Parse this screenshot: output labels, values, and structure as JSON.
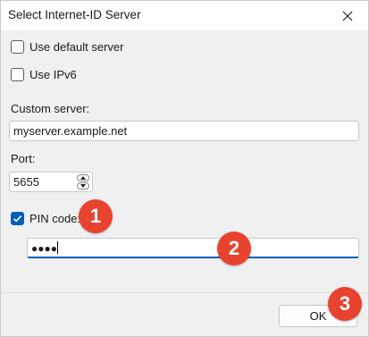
{
  "window": {
    "title": "Select Internet-ID Server",
    "close_icon": "close-icon"
  },
  "options": {
    "use_default_server": {
      "label": "Use default server",
      "checked": false
    },
    "use_ipv6": {
      "label": "Use IPv6",
      "checked": false
    }
  },
  "custom_server": {
    "label": "Custom server:",
    "value": "myserver.example.net"
  },
  "port": {
    "label": "Port:",
    "value": "5655"
  },
  "pin": {
    "label": "PIN code:",
    "checked": true,
    "value": "●●●●"
  },
  "footer": {
    "ok_label": "OK"
  },
  "callouts": [
    "1",
    "2",
    "3"
  ],
  "colors": {
    "accent": "#005fb8",
    "callout": "#e8432e"
  }
}
